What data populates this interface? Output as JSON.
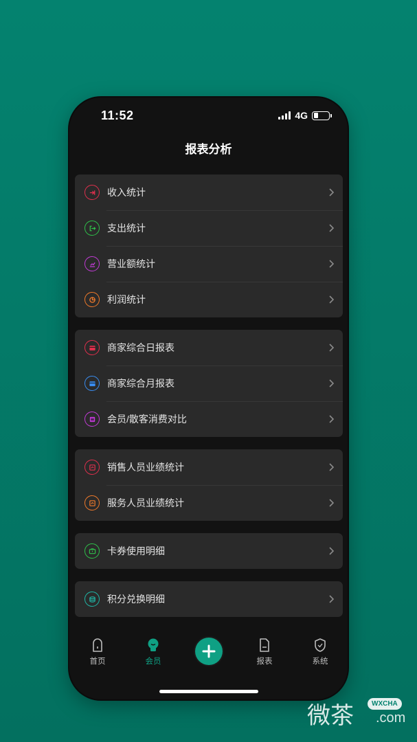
{
  "status": {
    "time": "11:52",
    "network": "4G"
  },
  "title": "报表分析",
  "groups": [
    [
      {
        "label": "收入统计",
        "icon": "income-icon",
        "color": "#e0304d"
      },
      {
        "label": "支出统计",
        "icon": "expense-icon",
        "color": "#2fc04a"
      },
      {
        "label": "营业额统计",
        "icon": "revenue-chart-icon",
        "color": "#c23bd6"
      },
      {
        "label": "利润统计",
        "icon": "pie-chart-icon",
        "color": "#f07a2a"
      }
    ],
    [
      {
        "label": "商家综合日报表",
        "icon": "daily-report-icon",
        "color": "#e0304d"
      },
      {
        "label": "商家综合月报表",
        "icon": "monthly-report-icon",
        "color": "#3a8df0"
      },
      {
        "label": "会员/散客消费对比",
        "icon": "compare-icon",
        "color": "#c23bd6"
      }
    ],
    [
      {
        "label": "销售人员业绩统计",
        "icon": "sales-performance-icon",
        "color": "#e0304d"
      },
      {
        "label": "服务人员业绩统计",
        "icon": "service-performance-icon",
        "color": "#f07a2a"
      }
    ],
    [
      {
        "label": "卡券使用明细",
        "icon": "coupon-icon",
        "color": "#2fc04a"
      }
    ],
    [
      {
        "label": "积分兑换明细",
        "icon": "points-icon",
        "color": "#1fb8a8"
      }
    ]
  ],
  "tabs": {
    "home": "首页",
    "member": "会员",
    "report": "报表",
    "system": "系统"
  },
  "colors": {
    "accent": "#0fa084",
    "background": "#121212",
    "card": "#2a2a2a"
  },
  "watermark": {
    "cn": "微茶",
    "badge": "WXCHA",
    "com": ".com"
  }
}
